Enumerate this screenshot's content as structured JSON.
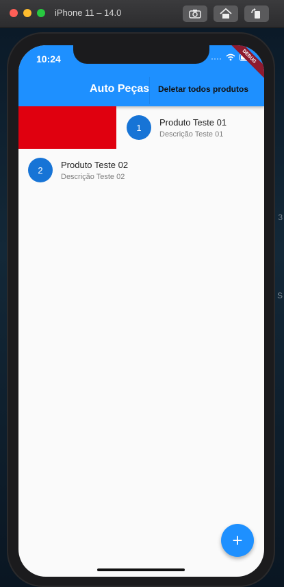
{
  "simulator": {
    "title": "iPhone 11 – 14.0"
  },
  "status_bar": {
    "time": "10:24",
    "debug_label": "DEBUG"
  },
  "app_bar": {
    "title": "Auto Peças",
    "action_label": "Deletar todos produtos",
    "color": "#1e90ff"
  },
  "products": [
    {
      "number": "1",
      "name": "Produto Teste 01",
      "description": "Descrição Teste 01",
      "swiped": true
    },
    {
      "number": "2",
      "name": "Produto Teste 02",
      "description": "Descrição Teste 02",
      "swiped": false
    }
  ],
  "fab": {
    "icon": "plus-icon",
    "symbol": "+"
  },
  "colors": {
    "delete_background": "#e0000f",
    "avatar": "#1774d6"
  }
}
